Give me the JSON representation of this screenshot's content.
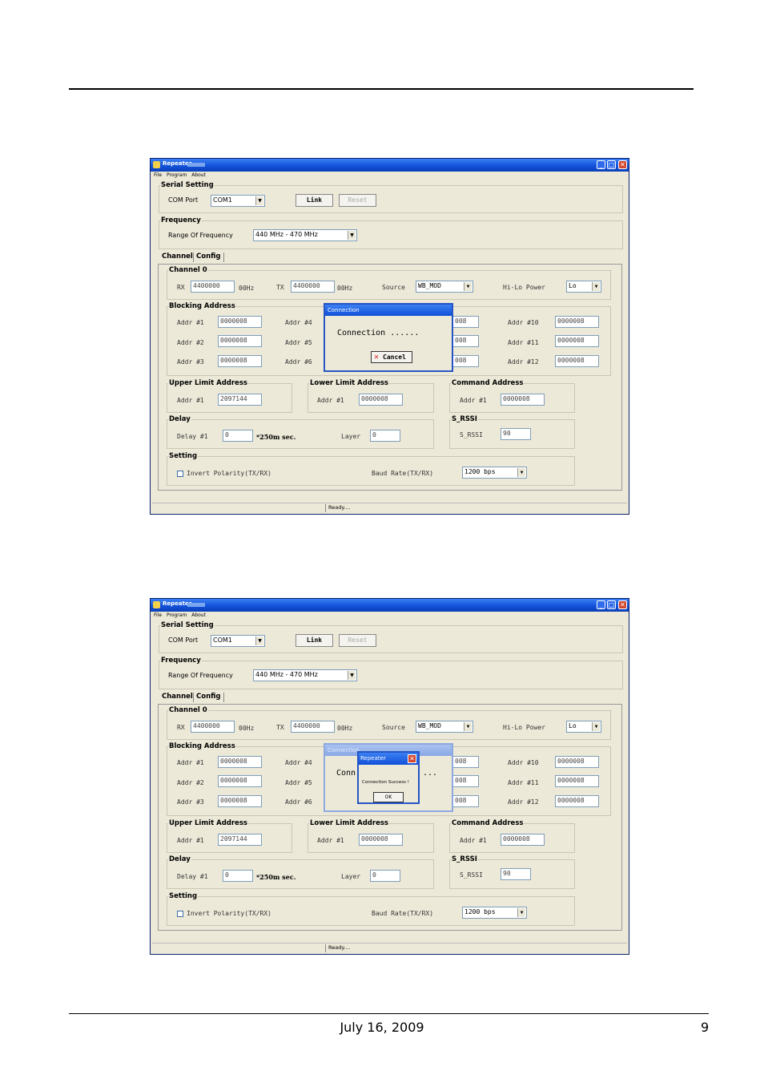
{
  "footer": {
    "date": "July 16, 2009",
    "page": "9"
  },
  "app": {
    "title": "Repeater",
    "menu": [
      "File",
      "Program",
      "About"
    ],
    "serial_setting": {
      "legend": "Serial Setting",
      "com_port_label": "COM Port",
      "com_port_value": "COM1",
      "link_label": "Link",
      "reset_label": "Reset"
    },
    "frequency": {
      "legend": "Frequency",
      "range_label": "Range Of Frequency",
      "range_value": "440 MHz - 470 MHz"
    },
    "tabs": [
      "Channel",
      "Config"
    ],
    "channel": {
      "legend": "Channel 0",
      "rx_label": "RX",
      "rx_value": "4400000",
      "rx_unit": "00Hz",
      "tx_label": "TX",
      "tx_value": "4400000",
      "tx_unit": "00Hz",
      "source_label": "Source",
      "source_value": "WB_MOD",
      "power_label": "Hi-Lo Power",
      "power_value": "Lo"
    },
    "blocking": {
      "legend": "Blocking Address",
      "col1": [
        {
          "label": "Addr #1",
          "value": "0000008"
        },
        {
          "label": "Addr #2",
          "value": "0000008"
        },
        {
          "label": "Addr #3",
          "value": "0000008"
        }
      ],
      "col2": [
        {
          "label": "Addr #4"
        },
        {
          "label": "Addr #5"
        },
        {
          "label": "Addr #6"
        }
      ],
      "col3": [
        {
          "value": "008"
        },
        {
          "value": "008"
        },
        {
          "value": "008"
        }
      ],
      "col4": [
        {
          "label": "Addr #10",
          "value": "0000008"
        },
        {
          "label": "Addr #11",
          "value": "0000008"
        },
        {
          "label": "Addr #12",
          "value": "0000008"
        }
      ]
    },
    "upper": {
      "legend": "Upper Limit Address",
      "label": "Addr #1",
      "value": "2097144"
    },
    "lower": {
      "legend": "Lower Limit Address",
      "label": "Addr #1",
      "value": "0000008"
    },
    "command": {
      "legend": "Command Address",
      "label": "Addr #1",
      "value": "0000008"
    },
    "delay": {
      "legend": "Delay",
      "label": "Delay #1",
      "value": "0",
      "unit": "*250m sec.",
      "layer_label": "Layer",
      "layer_value": "0"
    },
    "srssi": {
      "legend": "S_RSSI",
      "label": "S_RSSI",
      "value": "90"
    },
    "setting": {
      "legend": "Setting",
      "invert_label": "Invert Polarity(TX/RX)",
      "baud_label": "Baud Rate(TX/RX)",
      "baud_value": "1200 bps"
    },
    "status": "Ready...."
  },
  "dialog1": {
    "title": "Connection",
    "message": "Connection ......",
    "cancel_label": "Cancel"
  },
  "dialog2": {
    "conn_title": "Connection",
    "conn_msg_left": "Conn",
    "conn_msg_right": "...",
    "popup_title": "Repeater",
    "popup_message": "Connection Success !",
    "ok_label": "OK"
  },
  "colors": {
    "titlebar": "#1150d8",
    "window_bg": "#ece9d8",
    "close_button": "#d2462c"
  }
}
